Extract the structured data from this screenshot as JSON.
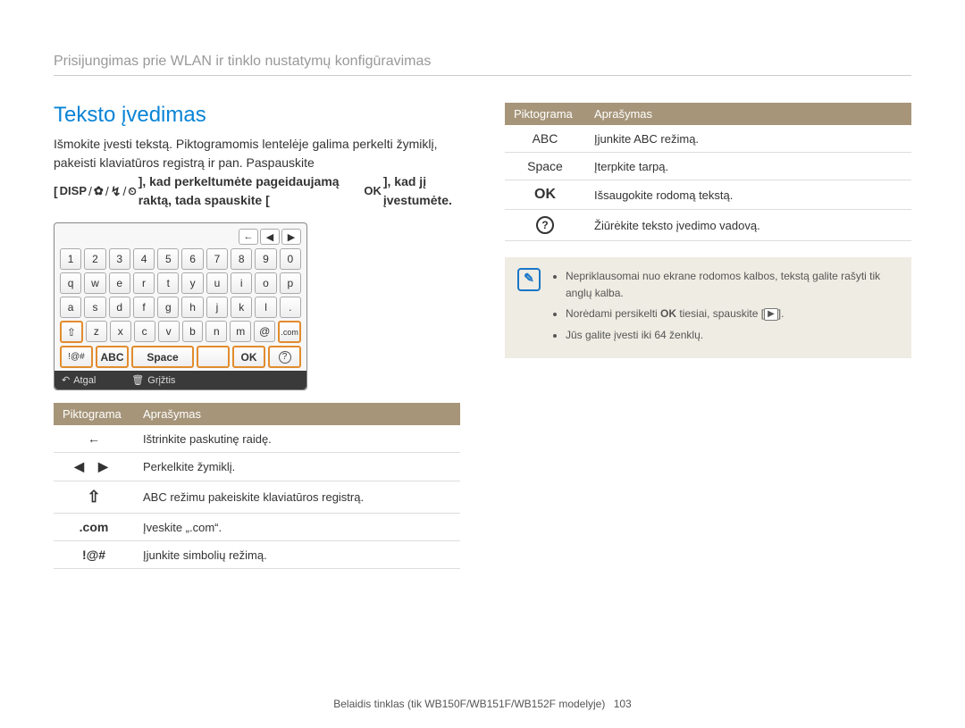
{
  "header": {
    "breadcrumb": "Prisijungimas prie WLAN ir tinklo nustatymų konfigūravimas"
  },
  "section": {
    "title": "Teksto įvedimas"
  },
  "intro": {
    "line1": "Išmokite įvesti tekstą. Piktogramomis lentelėje galima perkelti žymiklį, pakeisti klaviatūros registrą ir pan. Paspauskite",
    "line2a": "[",
    "disp": "DISP",
    "line2b": "], kad perkeltumėte pageidaujamą raktą, tada spauskite [",
    "ok": "OK",
    "line2c": "], kad jį įvestumėte."
  },
  "keyboard": {
    "nav": [
      "←",
      "◀",
      "▶"
    ],
    "rows": [
      [
        "1",
        "2",
        "3",
        "4",
        "5",
        "6",
        "7",
        "8",
        "9",
        "0"
      ],
      [
        "q",
        "w",
        "e",
        "r",
        "t",
        "y",
        "u",
        "i",
        "o",
        "p"
      ],
      [
        "a",
        "s",
        "d",
        "f",
        "g",
        "h",
        "j",
        "k",
        "l",
        "."
      ]
    ],
    "row4": [
      "⇧",
      "z",
      "x",
      "c",
      "v",
      "b",
      "n",
      "m",
      "@",
      ".com"
    ],
    "row5": [
      "!@#",
      "ABC",
      "Space",
      "",
      "OK",
      "?"
    ],
    "bottom": {
      "back": "Atgal",
      "trash": "Grįžtis"
    }
  },
  "table_left": {
    "head_icon": "Piktograma",
    "head_desc": "Aprašymas",
    "rows": [
      {
        "icon": "←",
        "desc": "Ištrinkite paskutinę raidę."
      },
      {
        "icon": "◀  ▶",
        "desc": "Perkelkite žymiklį."
      },
      {
        "icon": "⇧",
        "desc": "ABC režimu pakeiskite klaviatūros registrą."
      },
      {
        "icon": ".com",
        "desc": "Įveskite „.com“."
      },
      {
        "icon": "!@#",
        "desc": "Įjunkite simbolių režimą."
      }
    ]
  },
  "table_right": {
    "head_icon": "Piktograma",
    "head_desc": "Aprašymas",
    "rows": [
      {
        "icon": "ABC",
        "desc": "Įjunkite ABC režimą."
      },
      {
        "icon": "Space",
        "desc": "Įterpkite tarpą."
      },
      {
        "icon": "OK",
        "desc": "Išsaugokite rodomą tekstą."
      },
      {
        "icon": "?",
        "desc": "Žiūrėkite teksto įvedimo vadovą."
      }
    ]
  },
  "note": {
    "bullets": [
      "Nepriklausomai nuo ekrane rodomos kalbos, tekstą galite rašyti tik anglų kalba.",
      "Norėdami persikelti OK tiesiai, spauskite [▶].",
      "Jūs galite įvesti iki 64 ženklų."
    ]
  },
  "footer": {
    "text": "Belaidis tinklas (tik WB150F/WB151F/WB152F modelyje)",
    "page": "103"
  }
}
